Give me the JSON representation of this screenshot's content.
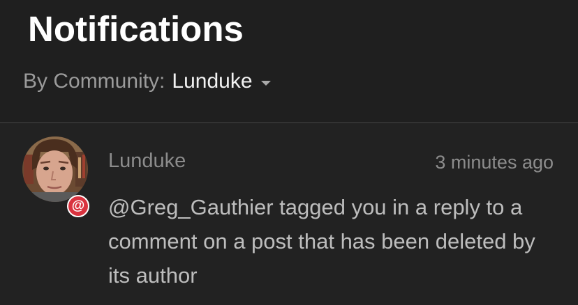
{
  "header": {
    "title": "Notifications",
    "filter_label": "By Community:",
    "filter_value": "Lunduke"
  },
  "notification": {
    "community": "Lunduke",
    "time_ago": "3 minutes ago",
    "message": "@Greg_Gauthier tagged you in a reply to a comment on a post that has been deleted by its author",
    "badge_symbol": "@",
    "badge_icon": "mention-icon",
    "badge_color": "#d9333f"
  }
}
